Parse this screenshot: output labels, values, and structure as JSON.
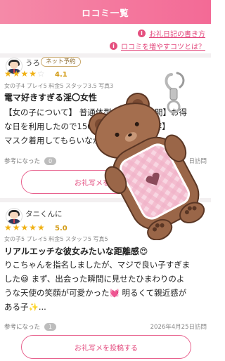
{
  "header": {
    "title": "ロコミ一覧"
  },
  "links": [
    {
      "label": "お礼日記の書き方"
    },
    {
      "label": "ロコミを増やすコツとは？"
    }
  ],
  "reviews": [
    {
      "username": "うろ",
      "badge": "ネット予約",
      "rating": 4.1,
      "rating_text": "4.1",
      "stars_on": "★★★★",
      "stars_off": "☆",
      "sub_scores": "女の子4 プレイ5 料金5 スタッフ3.5 写真3",
      "title": "電マ好きすぎる淫〇女性",
      "body_1": "【女の子について】 普通体型 【料金・時間】お得",
      "body_2": "な日を利用したので15000円 【プレイ内容】",
      "body_3": "マスク着用してもらいながらの施",
      "helpful_label": "参考になった",
      "helpful_count": "0",
      "visit_date": "日訪問",
      "button_label": "お礼写メを投稿する"
    },
    {
      "username": "タニくんに",
      "rating": 5.0,
      "rating_text": "5.0",
      "stars_on": "★★★★★",
      "sub_scores": "女の子5 プレイ5 料金5 スタッフ5 写真5",
      "title": "リアルエッチな彼女みたいな距離感😍",
      "body_1": "りこちゃんを指名しましたが、マジで良い子すぎま",
      "body_2": "した😆 まず、出会った瞬間に見せたひまわりのよ",
      "body_3": "うな天使の笑顔が可愛かった💓 明るくて親近感が",
      "body_4": "ある子✨...",
      "helpful_label": "参考になった",
      "helpful_count": "1",
      "visit_date": "2026年4月25日訪問",
      "button_label": "お礼写メを投稿する"
    }
  ],
  "colors": {
    "accent": "#e8628e",
    "star": "#f0b114"
  }
}
